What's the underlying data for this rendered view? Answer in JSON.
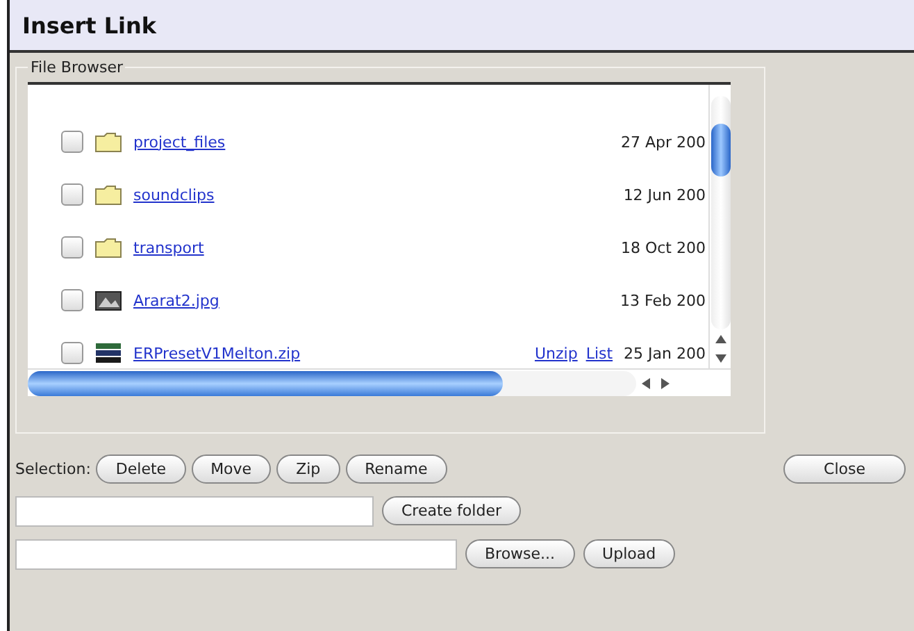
{
  "window": {
    "title": "Insert Link"
  },
  "file_browser": {
    "legend": "File Browser",
    "files": [
      {
        "kind": "folder",
        "name": "project_files",
        "date": "27 Apr 200",
        "checked": false
      },
      {
        "kind": "folder",
        "name": "soundclips",
        "date": "12 Jun 200",
        "checked": false
      },
      {
        "kind": "folder",
        "name": "transport",
        "date": "18 Oct 200",
        "checked": false
      },
      {
        "kind": "image",
        "name": "Ararat2.jpg",
        "date": "13 Feb 200",
        "checked": false
      },
      {
        "kind": "archive",
        "name": "ERPresetV1Melton.zip",
        "date": "25 Jan 200",
        "checked": false,
        "actions": [
          "Unzip",
          "List"
        ]
      }
    ]
  },
  "selection": {
    "label": "Selection:",
    "buttons": [
      "Delete",
      "Move",
      "Zip",
      "Rename"
    ]
  },
  "close_button": "Close",
  "create_folder_button": "Create folder",
  "upload": {
    "browse_button": "Browse...",
    "upload_button": "Upload"
  }
}
